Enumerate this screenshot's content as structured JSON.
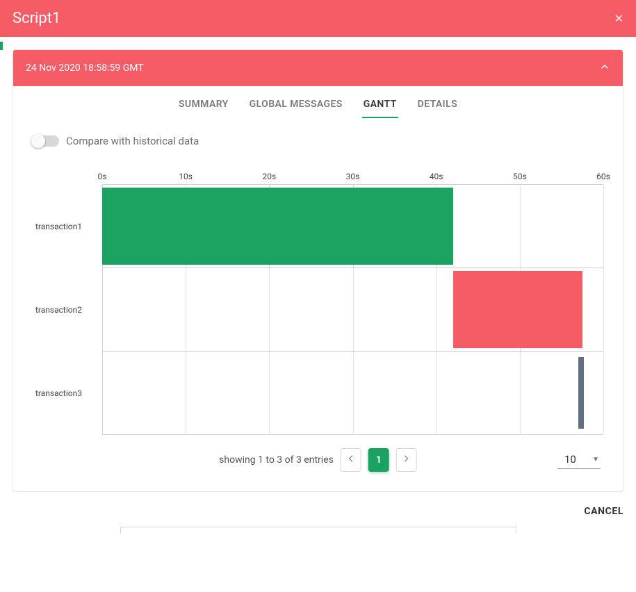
{
  "header": {
    "title": "Script1"
  },
  "card": {
    "timestamp": "24 Nov 2020 18:58:59 GMT"
  },
  "tabs": {
    "summary": "SUMMARY",
    "global_messages": "GLOBAL MESSAGES",
    "gantt": "GANTT",
    "details": "DETAILS"
  },
  "toggle": {
    "label": "Compare with historical data"
  },
  "chart_data": {
    "type": "bar",
    "title": "",
    "xlabel": "",
    "ylabel": "",
    "xlim": [
      0,
      60
    ],
    "x_ticks": [
      "0s",
      "10s",
      "20s",
      "30s",
      "40s",
      "50s",
      "60s"
    ],
    "categories": [
      "transaction1",
      "transaction2",
      "transaction3"
    ],
    "series": [
      {
        "name": "transaction1",
        "start": 0,
        "end": 42,
        "color": "#1aa260"
      },
      {
        "name": "transaction2",
        "start": 42,
        "end": 57.5,
        "color": "#f65c66"
      },
      {
        "name": "transaction3",
        "start": 57,
        "end": 57.7,
        "color": "#607080"
      }
    ]
  },
  "pagination": {
    "summary": "showing 1 to 3 of 3 entries",
    "current": "1",
    "page_size": "10"
  },
  "footer": {
    "cancel": "CANCEL"
  }
}
